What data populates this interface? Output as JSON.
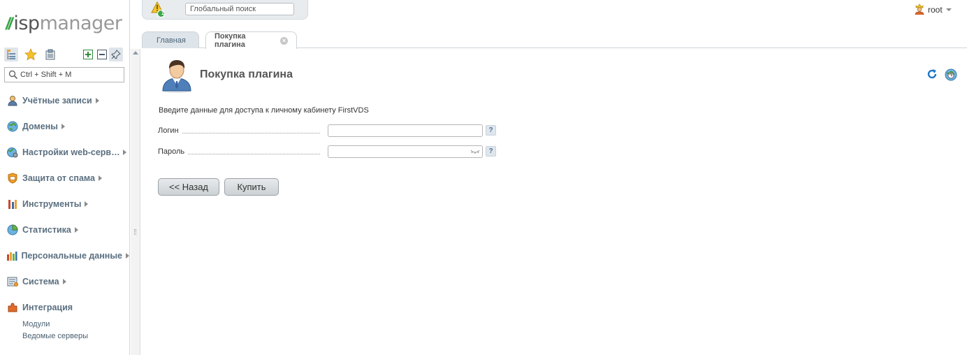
{
  "app": {
    "logo_isp": "isp",
    "logo_manager": "manager"
  },
  "topbar": {
    "alert_count": "1",
    "global_search_placeholder": "Глобальный поиск",
    "user": "root"
  },
  "menu_search": {
    "placeholder": "Ctrl + Shift + M"
  },
  "menu": {
    "items": [
      {
        "label": "Учётные записи",
        "icon": "users-icon"
      },
      {
        "label": "Домены",
        "icon": "globe-icon"
      },
      {
        "label": "Настройки web-серв…",
        "icon": "web-settings-icon"
      },
      {
        "label": "Защита от спама",
        "icon": "spam-shield-icon"
      },
      {
        "label": "Инструменты",
        "icon": "tools-icon"
      },
      {
        "label": "Статистика",
        "icon": "pie-chart-icon"
      },
      {
        "label": "Персональные данные",
        "icon": "bar-chart-icon"
      },
      {
        "label": "Система",
        "icon": "system-icon"
      },
      {
        "label": "Интеграция",
        "icon": "puzzle-icon"
      }
    ],
    "integration_sub": [
      "Модули",
      "Ведомые серверы"
    ]
  },
  "tabs": [
    {
      "label": "Главная",
      "active": false
    },
    {
      "label": "Покупка плагина",
      "active": true
    }
  ],
  "form": {
    "title": "Покупка плагина",
    "intro": "Введите данные для доступа к личному кабинету FirstVDS",
    "fields": [
      {
        "label": "Логин",
        "value": "",
        "hint": "?"
      },
      {
        "label": "Пароль",
        "value": "",
        "hint": "?"
      }
    ],
    "buttons": {
      "back": "<< Назад",
      "buy": "Купить"
    }
  },
  "colors": {
    "brand_green": "#3aa64a",
    "menu_text": "#5a6f80",
    "tab_inactive_bg": "#dde4ea"
  }
}
